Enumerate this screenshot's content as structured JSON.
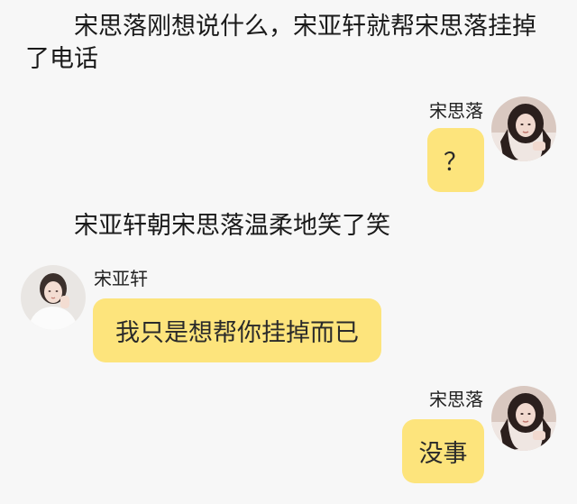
{
  "narration": {
    "line1": "宋思落刚想说什么，宋亚轩就帮宋思落挂掉了电话",
    "line2": "宋亚轩朝宋思落温柔地笑了笑"
  },
  "messages": [
    {
      "sender": "宋思落",
      "text": "？",
      "side": "right",
      "avatar": "girl-avatar-icon"
    },
    {
      "sender": "宋亚轩",
      "text": "我只是想帮你挂掉而已",
      "side": "left",
      "avatar": "boy-avatar-icon"
    },
    {
      "sender": "宋思落",
      "text": "没事",
      "side": "right",
      "avatar": "girl-avatar-icon"
    }
  ],
  "colors": {
    "background": "#f7f7f7",
    "bubble": "#fde47c",
    "text": "#1a1a1a"
  }
}
